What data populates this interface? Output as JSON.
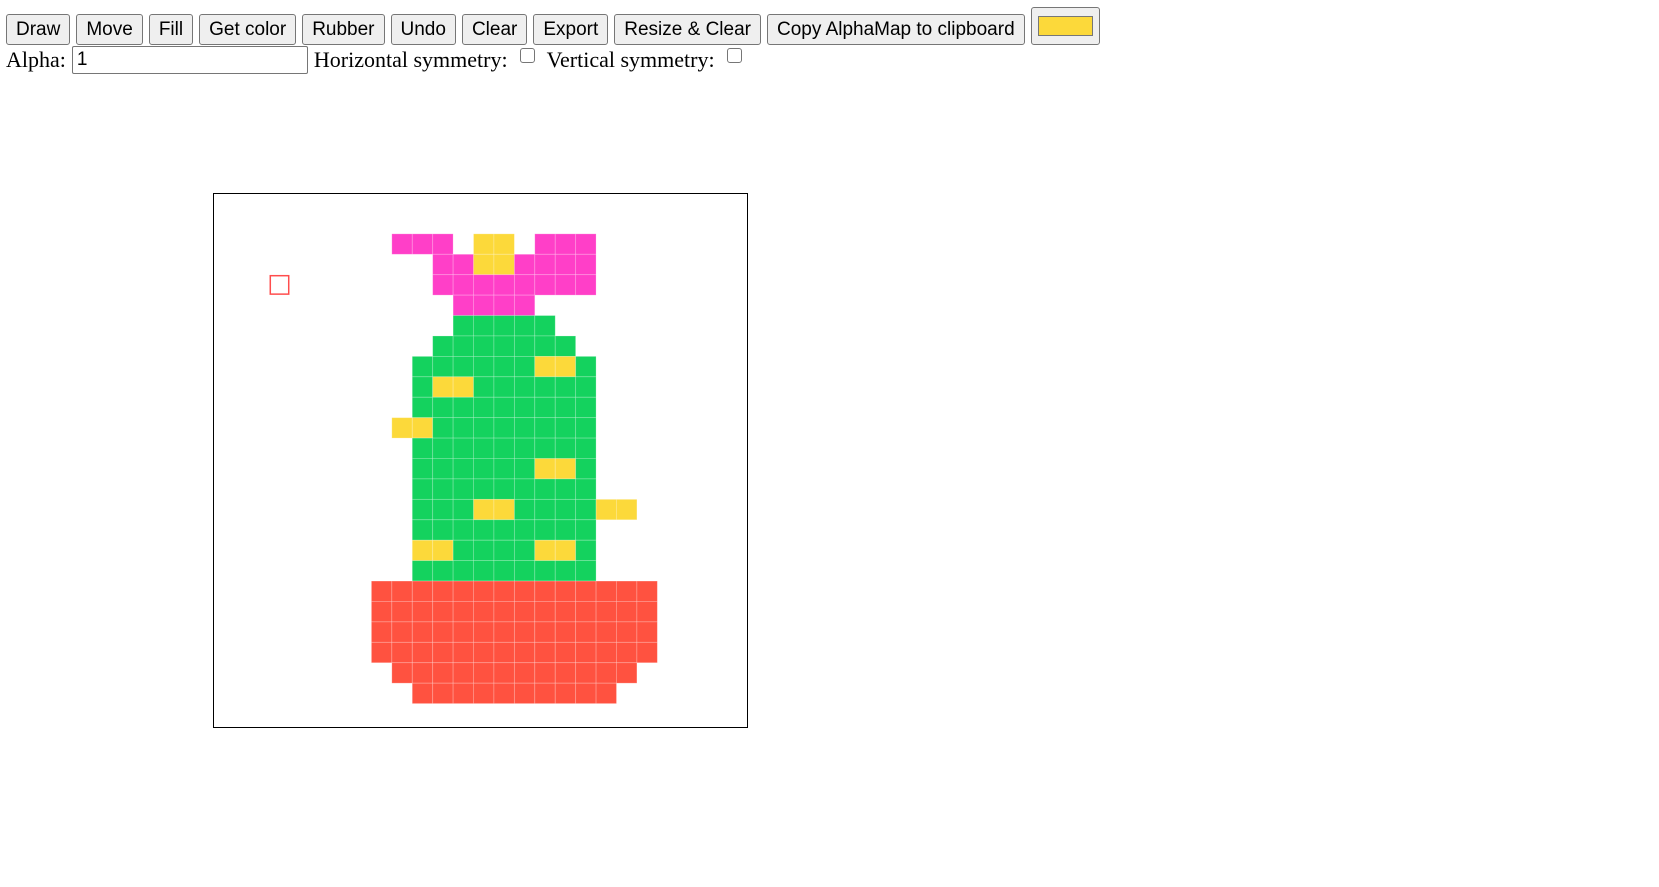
{
  "toolbar": {
    "draw_label": "Draw",
    "move_label": "Move",
    "fill_label": "Fill",
    "get_color_label": "Get color",
    "rubber_label": "Rubber",
    "undo_label": "Undo",
    "clear_label": "Clear",
    "export_label": "Export",
    "resize_clear_label": "Resize & Clear",
    "copy_alphamap_label": "Copy AlphaMap to clipboard",
    "current_color": "#fcd93a"
  },
  "options": {
    "alpha_label": "Alpha:",
    "alpha_value": "1",
    "hsym_label": "Horizontal symmetry:",
    "hsym_checked": false,
    "vsym_label": "Vertical symmetry:",
    "vsym_checked": false
  },
  "canvas": {
    "palette": {
      "M": "#ff3fc8",
      "Y": "#fcd93a",
      "G": "#14d25e",
      "R": "#ff5240"
    },
    "grid_line_color": "rgba(255,255,255,0.28)",
    "cursor_color": "#ff4d4d",
    "cursor_cell": [
      2,
      2
    ],
    "origin_cell": [
      6,
      2
    ],
    "rows": [
      "...MMM.YY.MMM.",
      ".....MMYYMMMM.",
      ".....MMMMMMMM.",
      "......MMMM....",
      "......GGGGG...",
      ".....GGGGGGG..",
      "....GGGGGGYYG.",
      "....GYYGGGGGG.",
      "....GGGGGGGGG.",
      "...YYGGGGGGGG.",
      "....GGGGGGGGG.",
      "....GGGGGGYYG.",
      "....GGGGGGGGG.",
      "....GGGYYGGGGYY",
      "....GGGGGGGGG.",
      "....YYGGGGYYG.",
      "....GGGGGGGGG.",
      "..RRRRRRRRRRRRRR",
      "..RRRRRRRRRRRRRR",
      "..RRRRRRRRRRRRRR",
      "..RRRRRRRRRRRRRR",
      "...RRRRRRRRRRRR",
      "....RRRRRRRRRR"
    ]
  }
}
